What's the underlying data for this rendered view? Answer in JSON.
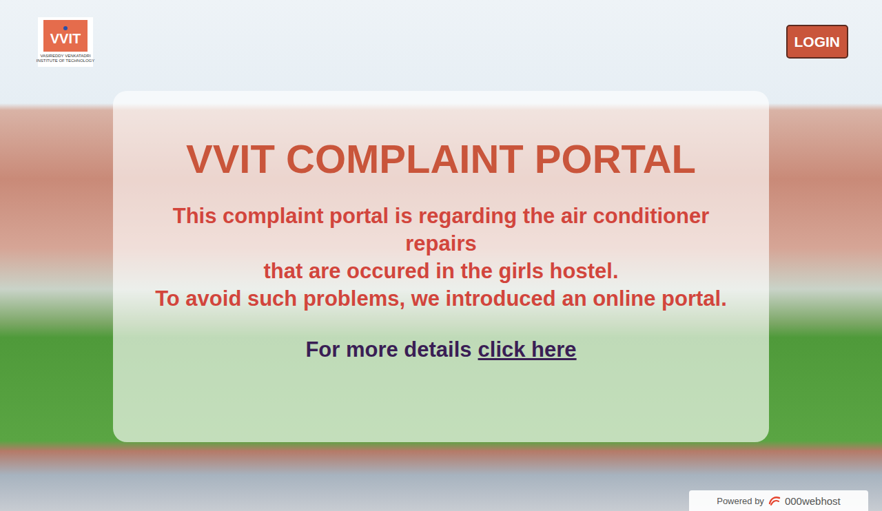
{
  "logo": {
    "text": "VVIT",
    "caption": [
      "VASIREDDY VENKATADRI",
      "INSTITUTE OF TECHNOLOGY"
    ]
  },
  "header": {
    "login_button": "LOGIN"
  },
  "card": {
    "title": "VVIT COMPLAINT PORTAL",
    "lines": [
      "This complaint portal is regarding the air conditioner repairs",
      "that are occured in the girls hostel.",
      "To avoid such problems, we introduced an online portal."
    ],
    "details": {
      "prefix": "For more details",
      "link": "click here"
    }
  },
  "footer": {
    "powered_by": "Powered by",
    "host": "000webhost"
  }
}
